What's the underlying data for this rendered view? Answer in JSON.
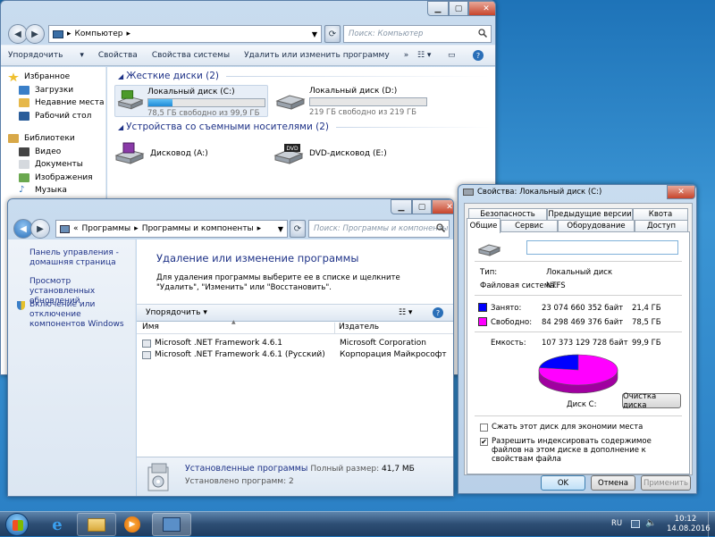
{
  "computer_window": {
    "breadcrumb_root": "Компьютер",
    "search_placeholder": "Поиск: Компьютер",
    "toolbar": {
      "organize": "Упорядочить",
      "properties": "Свойства",
      "system_properties": "Свойства системы",
      "uninstall": "Удалить или изменить программу",
      "more": "»"
    },
    "nav": {
      "favorites": "Избранное",
      "downloads": "Загрузки",
      "recent": "Недавние места",
      "desktop": "Рабочий стол",
      "libraries": "Библиотеки",
      "video": "Видео",
      "documents": "Документы",
      "pictures": "Изображения",
      "music": "Музыка"
    },
    "groups": {
      "hard_disks": "Жесткие диски (2)",
      "removable": "Устройства со съемными носителями (2)"
    },
    "drives": [
      {
        "name": "Локальный диск (C:)",
        "free": "78,5 ГБ свободно из 99,9 ГБ",
        "used_fraction": 0.21
      },
      {
        "name": "Локальный диск (D:)",
        "free": "219 ГБ свободно из 219 ГБ",
        "used_fraction": 0.0
      }
    ],
    "removable": [
      {
        "name": "Дисковод (A:)"
      },
      {
        "name": "DVD-дисковод (E:)",
        "badge": "DVD"
      }
    ]
  },
  "programs_window": {
    "breadcrumb": [
      "«",
      "Программы",
      "Программы и компоненты"
    ],
    "search_placeholder": "Поиск: Программы и компоненты",
    "sidebar": {
      "home": "Панель управления - домашняя страница",
      "updates": "Просмотр установленных обновлений",
      "features": "Включение или отключение компонентов Windows"
    },
    "heading": "Удаление или изменение программы",
    "description": "Для удаления программы выберите ее в списке и щелкните \"Удалить\", \"Изменить\" или \"Восстановить\".",
    "toolbar_organize": "Упорядочить",
    "columns": {
      "name": "Имя",
      "publisher": "Издатель"
    },
    "rows": [
      {
        "name": "Microsoft .NET Framework 4.6.1",
        "publisher": "Microsoft Corporation"
      },
      {
        "name": "Microsoft .NET Framework 4.6.1 (Русский)",
        "publisher": "Корпорация Майкрософт"
      }
    ],
    "status": {
      "label": "Установленные программы",
      "size_label": "Полный размер:",
      "size_value": "41,7 МБ",
      "count": "Установлено программ: 2"
    }
  },
  "properties_dialog": {
    "title": "Свойства: Локальный диск (C:)",
    "tabs_row1": [
      "Безопасность",
      "Предыдущие версии",
      "Квота"
    ],
    "tabs_row2": [
      "Общие",
      "Сервис",
      "Оборудование",
      "Доступ"
    ],
    "type_label": "Тип:",
    "type_value": "Локальный диск",
    "fs_label": "Файловая система:",
    "fs_value": "NTFS",
    "used_label": "Занято:",
    "used_bytes": "23 074 660 352 байт",
    "used_gb": "21,4 ГБ",
    "free_label": "Свободно:",
    "free_bytes": "84 298 469 376 байт",
    "free_gb": "78,5 ГБ",
    "capacity_label": "Емкость:",
    "capacity_bytes": "107 373 129 728 байт",
    "capacity_gb": "99,9 ГБ",
    "disk_label": "Диск C:",
    "cleanup": "Очистка диска",
    "compress": "Сжать этот диск для экономии места",
    "index": "Разрешить индексировать содержимое файлов на этом диске в дополнение к свойствам файла",
    "ok": "OK",
    "cancel": "Отмена",
    "apply": "Применить",
    "used_color": "#0000ff",
    "free_color": "#ff00ff"
  },
  "taskbar": {
    "lang": "RU",
    "time": "10:12",
    "date": "14.08.2016"
  }
}
